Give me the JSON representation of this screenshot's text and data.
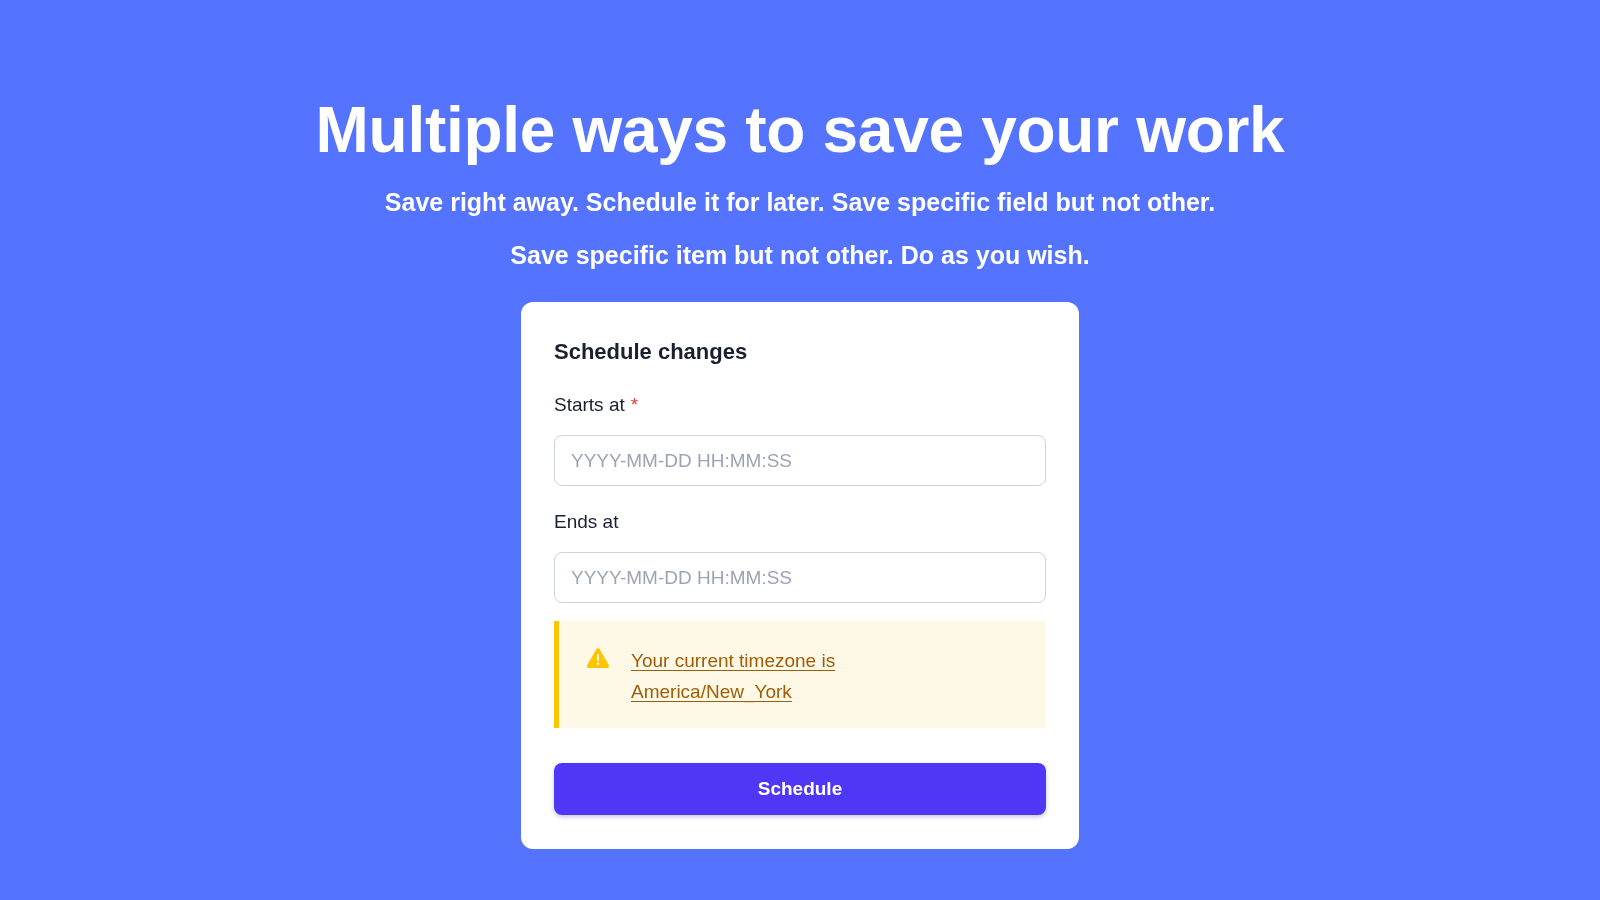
{
  "hero": {
    "title": "Multiple ways to save your work",
    "subtitle_lines": [
      "Save right away. Schedule it for later. Save specific field but not other.",
      "Save specific item but not other. Do as you wish."
    ]
  },
  "card": {
    "title": "Schedule changes",
    "fields": [
      {
        "label": "Starts at",
        "required_mark": "*",
        "placeholder": "YYYY-MM-DD HH:MM:SS"
      },
      {
        "label": "Ends at",
        "placeholder": "YYYY-MM-DD HH:MM:SS"
      }
    ],
    "alert": {
      "text": "Your current timezone is America/New_York"
    },
    "button": {
      "label": "Schedule"
    }
  }
}
